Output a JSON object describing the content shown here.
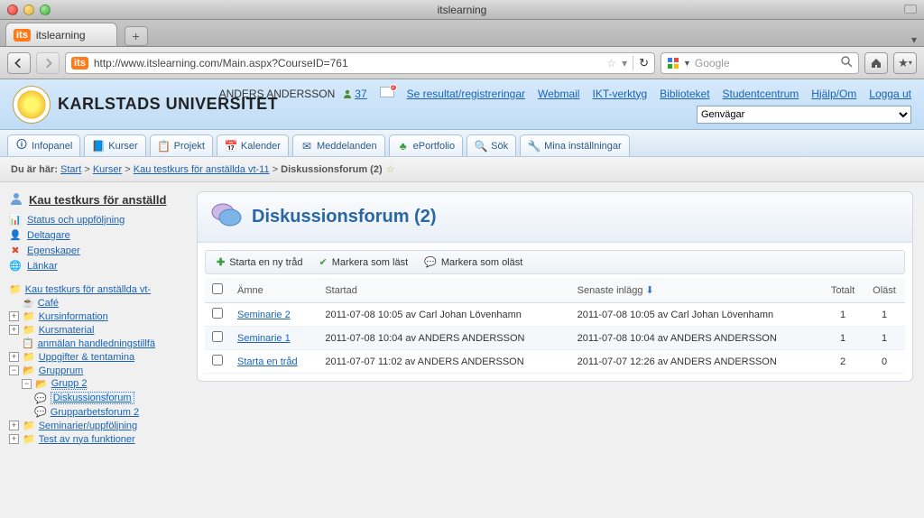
{
  "window": {
    "title": "itslearning"
  },
  "browser": {
    "tab_label": "itslearning",
    "url": "http://www.itslearning.com/Main.aspx?CourseID=761",
    "search_placeholder": "Google"
  },
  "header": {
    "university": "KARLSTADS UNIVERSITET",
    "user": "ANDERS ANDERSSON",
    "online_count": "37",
    "links": {
      "results": "Se resultat/registreringar",
      "webmail": "Webmail",
      "ikt": "IKT-verktyg",
      "library": "Biblioteket",
      "studentcenter": "Studentcentrum",
      "help": "Hjälp/Om",
      "logout": "Logga ut"
    },
    "shortcut_label": "Genvägar"
  },
  "mainnav": {
    "infopanel": "Infopanel",
    "kurser": "Kurser",
    "projekt": "Projekt",
    "kalender": "Kalender",
    "meddelanden": "Meddelanden",
    "eportfolio": "ePortfolio",
    "sok": "Sök",
    "installningar": "Mina inställningar"
  },
  "breadcrumb": {
    "prefix": "Du är här:",
    "start": "Start",
    "kurser": "Kurser",
    "course": "Kau testkurs för anställda vt-11",
    "current": "Diskussionsforum (2)"
  },
  "sidebar": {
    "course_title": "Kau testkurs för anställd",
    "links": {
      "status": "Status och uppföljning",
      "deltagare": "Deltagare",
      "egenskaper": "Egenskaper",
      "lankar": "Länkar"
    },
    "tree": {
      "root": "Kau testkurs för anställda vt-",
      "cafe": "Café",
      "kursinfo": "Kursinformation",
      "kursmaterial": "Kursmaterial",
      "anmalan": "anmälan handledningstillfä",
      "uppgifter": "Uppgifter & tentamina",
      "grupprum": "Grupprum",
      "grupp2": "Grupp 2",
      "diskussionsforum": "Diskussionsforum",
      "grupparbetsforum": "Grupparbetsforum 2",
      "seminarier": "Seminarier/uppföljning",
      "testnya": "Test av nya funktioner"
    }
  },
  "panel": {
    "title": "Diskussionsforum (2)",
    "toolbar": {
      "new_thread": "Starta en ny tråd",
      "mark_read": "Markera som läst",
      "mark_unread": "Markera som oläst"
    },
    "columns": {
      "subject": "Ämne",
      "started": "Startad",
      "latest": "Senaste inlägg",
      "total": "Totalt",
      "unread": "Oläst"
    },
    "rows": [
      {
        "subject": "Seminarie 2",
        "started": "2011-07-08 10:05 av Carl Johan Lövenhamn",
        "latest": "2011-07-08 10:05 av Carl Johan Lövenhamn",
        "total": "1",
        "unread": "1"
      },
      {
        "subject": "Seminarie 1",
        "started": "2011-07-08 10:04 av ANDERS ANDERSSON",
        "latest": "2011-07-08 10:04 av ANDERS ANDERSSON",
        "total": "1",
        "unread": "1"
      },
      {
        "subject": "Starta en tråd",
        "started": "2011-07-07 11:02 av ANDERS ANDERSSON",
        "latest": "2011-07-07 12:26 av ANDERS ANDERSSON",
        "total": "2",
        "unread": "0"
      }
    ]
  }
}
